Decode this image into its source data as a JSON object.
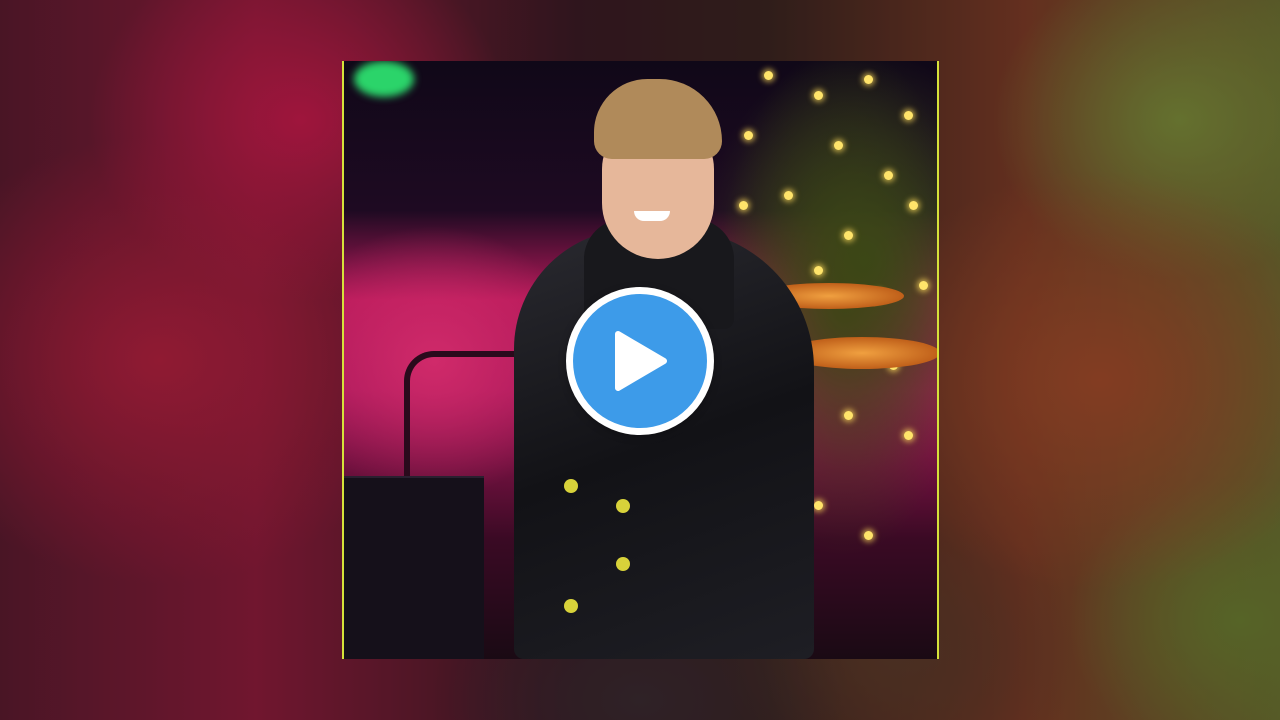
{
  "player": {
    "state": "paused",
    "play_button_icon": "play-icon",
    "accent_color": "#3d9be9",
    "frame_border_color": "#d6e23a"
  },
  "thumbnail": {
    "icon": "video-thumbnail"
  }
}
